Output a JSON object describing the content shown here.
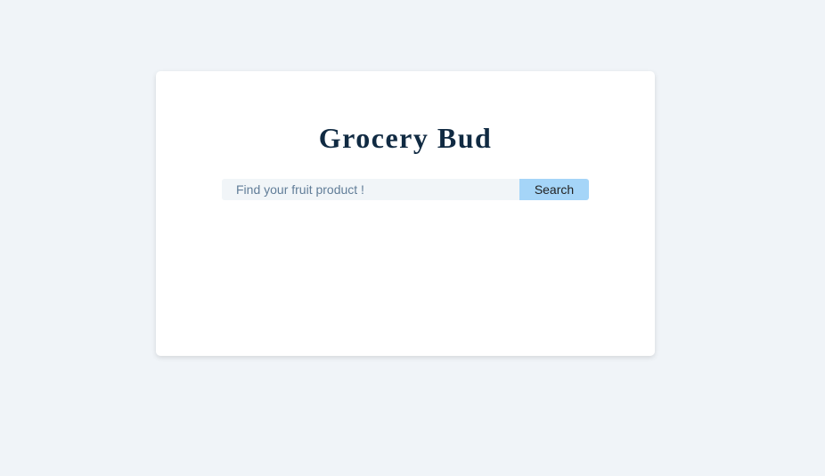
{
  "app": {
    "title": "Grocery Bud"
  },
  "search": {
    "placeholder": "Find your fruit product !",
    "value": "",
    "button_label": "Search"
  },
  "colors": {
    "background": "#f0f4f8",
    "card": "#ffffff",
    "title": "#102a42",
    "input_background": "#f1f5f8",
    "button_background": "#a5d5f8"
  }
}
